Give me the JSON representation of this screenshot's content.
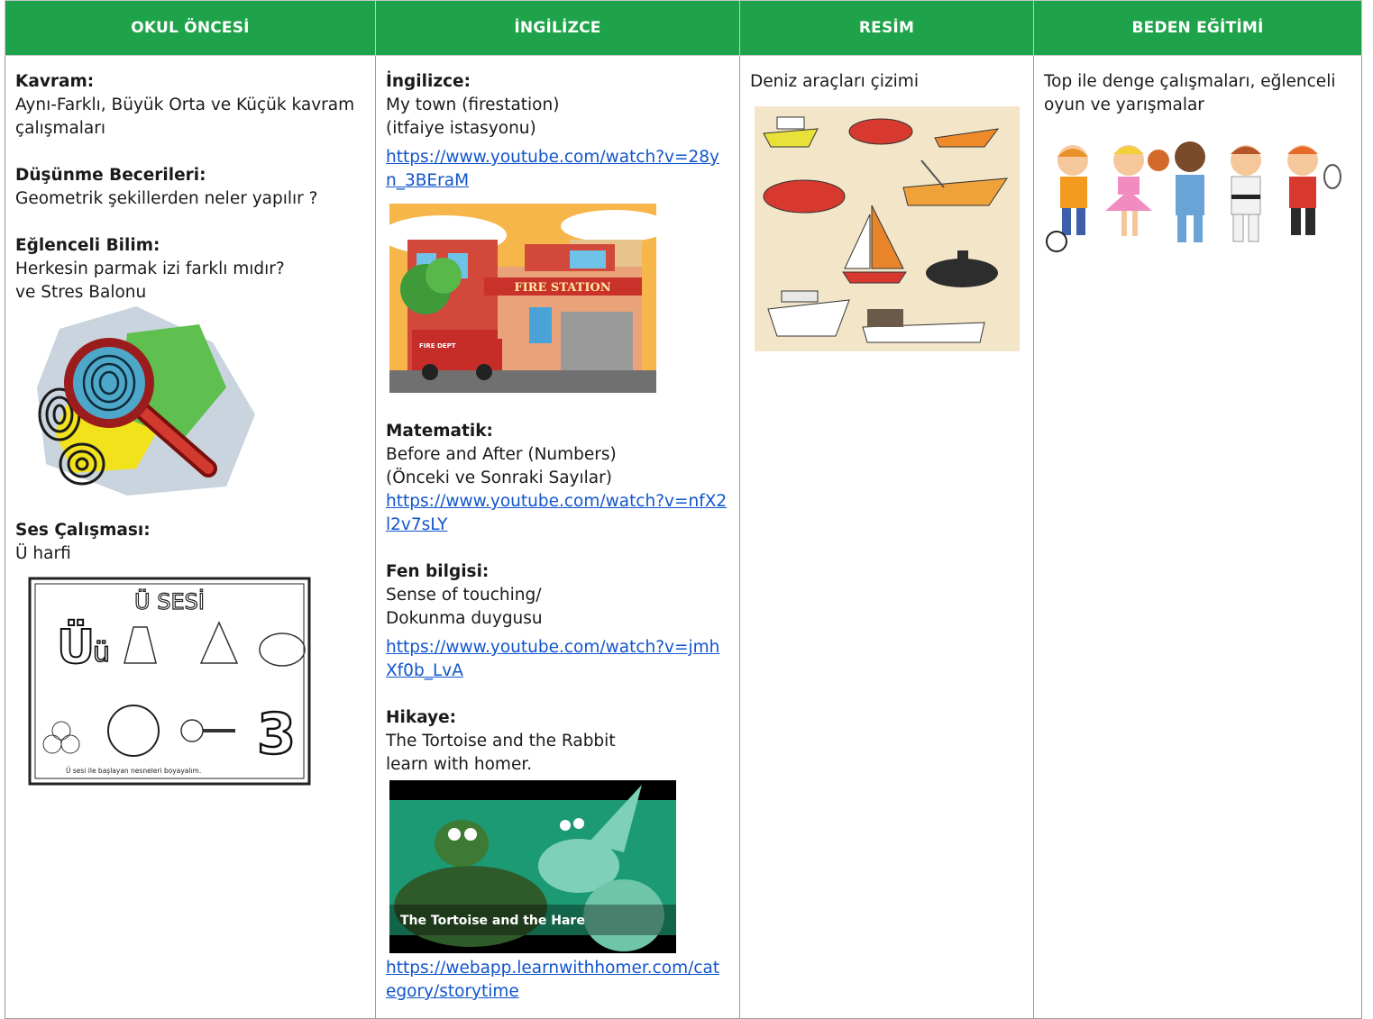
{
  "headers": [
    "OKUL ÖNCESİ",
    "İNGİLİZCE",
    "RESİM",
    "BEDEN EĞİTİMİ"
  ],
  "okul_oncesi": {
    "kavram_title": "Kavram:",
    "kavram_text": "Aynı-Farklı, Büyük Orta ve Küçük kavram çalışmaları",
    "dusunme_title": "Düşünme Becerileri:",
    "dusunme_text": "Geometrik şekillerden neler yapılır ?",
    "bilim_title": "Eğlenceli Bilim:",
    "bilim_text_1": "Herkesin parmak izi farklı mıdır?",
    "bilim_text_2": "ve Stres Balonu",
    "ses_title": "Ses Çalışması:",
    "ses_text": "Ü harfi",
    "worksheet_letters": "Ü  SESİ",
    "worksheet_caption": "Ü sesi ile başlayan nesneleri boyayalım."
  },
  "ingilizce": {
    "title": "İngilizce:",
    "line1": "My town (firestation)",
    "line2": "(itfaiye istasyonu)",
    "link1": "https://www.youtube.com/watch?v=28yn_3BEraM",
    "fire_station_sign": "FIRE STATION",
    "truck_label": "FIRE DEPT",
    "mat_title": "Matematik:",
    "mat_line1": "Before and After (Numbers)",
    "mat_line2": "(Önceki ve Sonraki Sayılar)",
    "link2": "https://www.youtube.com/watch?v=nfX2l2v7sLY",
    "fen_title": "Fen bilgisi:",
    "fen_line1": "Sense of touching/",
    "fen_line2": "Dokunma duygusu",
    "link3": "https://www.youtube.com/watch?v=jmhXf0b_LvA",
    "hikaye_title": "Hikaye:",
    "hikaye_line1": "The Tortoise and the Rabbit",
    "hikaye_line2": "learn with homer.",
    "video_caption": "The Tortoise and the Hare",
    "link4": "https://webapp.learnwithhomer.com/category/storytime"
  },
  "resim": {
    "text": "Deniz araçları çizimi"
  },
  "beden": {
    "text": "Top ile denge çalışmaları, eğlenceli oyun ve yarışmalar"
  },
  "colors": {
    "header_bg": "#1fa34a",
    "link": "#1155cc"
  }
}
